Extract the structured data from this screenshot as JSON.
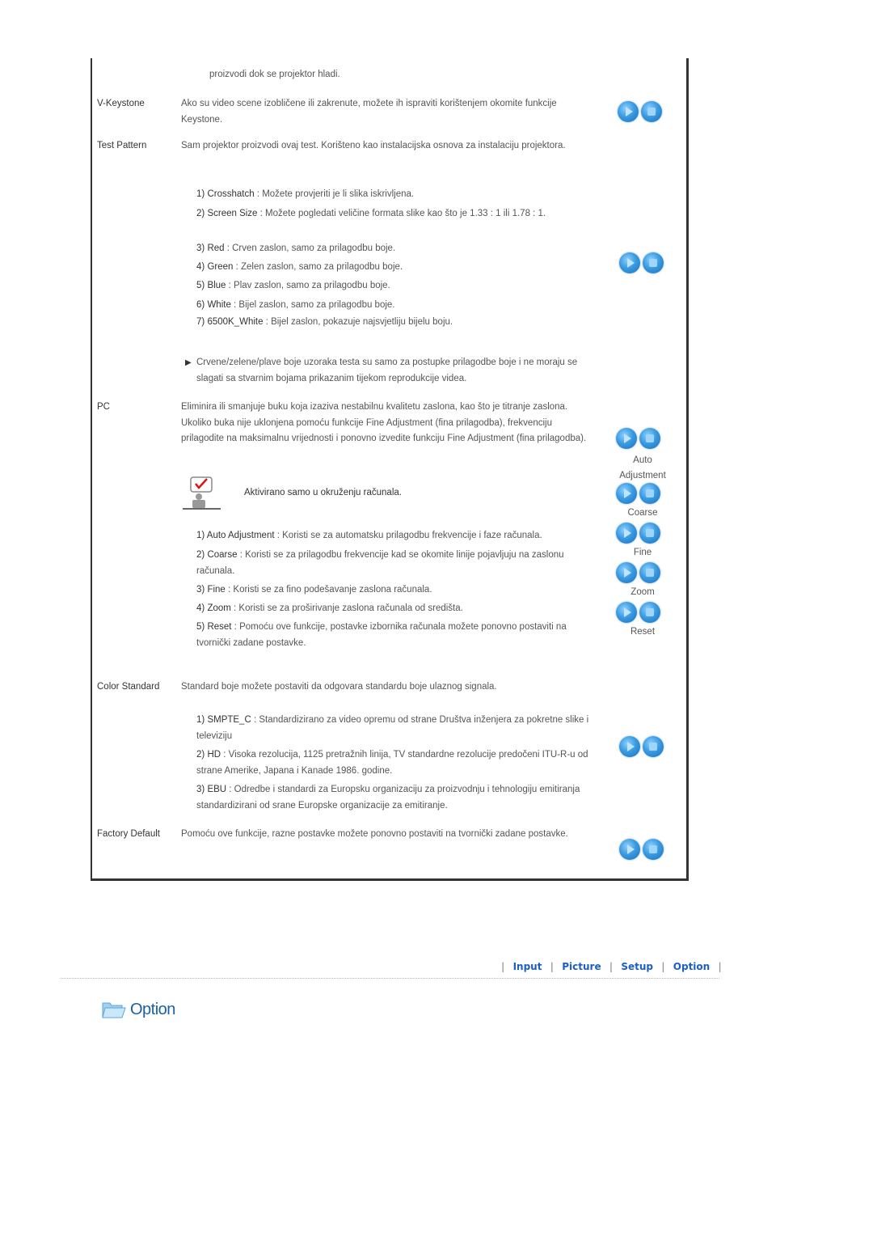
{
  "intro_tail": "proizvodi dok se projektor hladi.",
  "vkeystone": {
    "label": "V-Keystone",
    "desc": "Ako su video scene izobličene ili zakrenute, možete ih ispraviti korištenjem okomite funkcije Keystone."
  },
  "test_pattern": {
    "label": "Test Pattern",
    "desc": "Sam projektor proizvodi ovaj test. Korišteno kao instalacijska osnova za instalaciju projektora.",
    "items": [
      {
        "num": "1)",
        "key": "Crosshatch",
        "text": " : Možete provjeriti je li slika iskrivljena."
      },
      {
        "num": "2)",
        "key": "Screen Size",
        "text": " : Možete pogledati veličine formata slike kao što je 1.33 : 1 ili 1.78 : 1."
      },
      {
        "num": "3)",
        "key": "Red",
        "text": " : Crven zaslon, samo za prilagodbu boje."
      },
      {
        "num": "4)",
        "key": "Green",
        "text": " : Zelen zaslon, samo za prilagodbu boje."
      },
      {
        "num": "5)",
        "key": "Blue",
        "text": " : Plav zaslon, samo za prilagodbu boje."
      },
      {
        "num": "6)",
        "key": "White",
        "text": " : Bijel zaslon, samo za prilagodbu boje."
      },
      {
        "num": "7)",
        "key": "6500K_White",
        "text": " : Bijel zaslon, pokazuje najsvjetliju bijelu boju."
      }
    ],
    "note": "Crvene/zelene/plave boje uzoraka testa su samo za postupke prilagodbe boje i ne moraju se slagati sa stvarnim bojama prikazanim tijekom reprodukcije videa."
  },
  "pc": {
    "label": "PC",
    "desc": "Eliminira ili smanjuje buku koja izaziva nestabilnu kvalitetu zaslona, kao što je titranje zaslona. Ukoliko buka nije uklonjena pomoću funkcije Fine Adjustment (fina prilagodba), frekvenciju prilagodite na maksimalnu vrijednosti i ponovno izvedite funkciju Fine Adjustment (fina prilagodba).",
    "notice": "Aktivirano samo u okruženju računala.",
    "items": [
      {
        "num": "1)",
        "key": "Auto Adjustment",
        "text": " : Koristi se za automatsku prilagodbu frekvencije i faze računala."
      },
      {
        "num": "2)",
        "key": "Coarse",
        "text": " : Koristi se za prilagodbu frekvencije kad se okomite linije pojavljuju na zaslonu računala."
      },
      {
        "num": "3)",
        "key": "Fine",
        "text": " : Koristi se za fino podešavanje zaslona računala."
      },
      {
        "num": "4)",
        "key": "Zoom",
        "text": " : Koristi se za proširivanje zaslona računala od središta."
      },
      {
        "num": "5)",
        "key": "Reset",
        "text": " : Pomoću ove funkcije, postavke izbornika računala možete ponovno postaviti na tvornički zadane postavke."
      }
    ],
    "captions": [
      "Auto Adjustment",
      "Coarse",
      "Fine",
      "Zoom",
      "Reset"
    ]
  },
  "color_standard": {
    "label": "Color Standard",
    "desc": "Standard boje možete postaviti da odgovara standardu boje ulaznog signala.",
    "items": [
      {
        "num": "1)",
        "key": "SMPTE_C",
        "text": " : Standardizirano za video opremu od strane Društva inženjera za pokretne slike i televiziju"
      },
      {
        "num": "2)",
        "key": "HD",
        "text": " : Visoka rezolucija, 1125 pretražnih linija, TV standardne rezolucije predočeni ITU-R-u od strane Amerike, Japana i Kanade 1986. godine."
      },
      {
        "num": "3)",
        "key": "EBU",
        "text": " : Odredbe i standardi za Europsku organizaciju za proizvodnju i tehnologiju emitiranja standardizirani od srane Europske organizacije za emitiranje."
      }
    ]
  },
  "factory_default": {
    "label": "Factory Default",
    "desc": "Pomoću ove funkcije, razne postavke možete ponovno postaviti na tvornički zadane postavke."
  },
  "nav": {
    "separator": "|",
    "links": [
      "Input",
      "Picture",
      "Setup",
      "Option"
    ]
  },
  "section_title": "Option",
  "colors": {
    "link": "#1a5fc7",
    "title": "#1b5fa8",
    "button": "#3a9be0"
  }
}
